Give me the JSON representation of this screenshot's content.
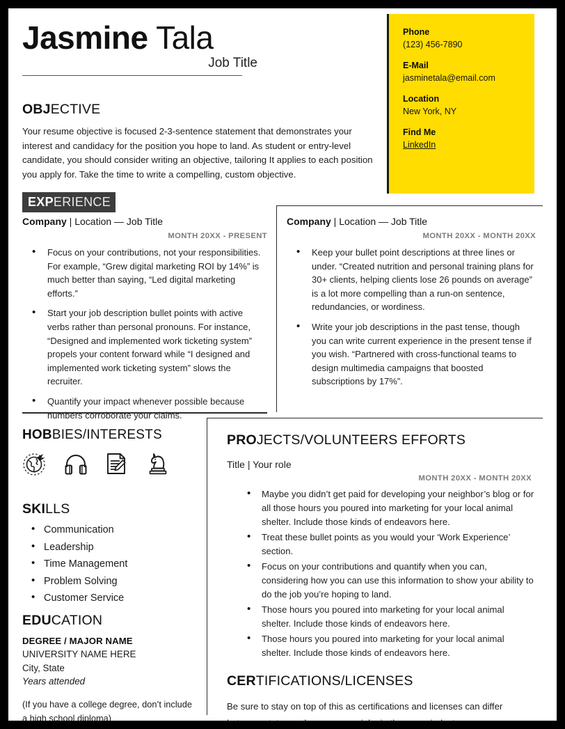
{
  "header": {
    "first_name": "Jasmine",
    "last_name": " Tala",
    "job_title": "Job Title"
  },
  "contact": {
    "phone_label": "Phone",
    "phone_value": "(123) 456-7890",
    "email_label": "E-Mail",
    "email_value": "jasminetala@email.com",
    "location_label": "Location",
    "location_value": "New York, NY",
    "findme_label": "Find Me",
    "findme_value": "LinkedIn",
    "panel_color": "#FFDD00"
  },
  "objective": {
    "title_bold": "OBJ",
    "title_light": "ECTIVE",
    "body": "Your resume objective is focused 2-3-sentence statement that demonstrates your interest and candidacy for the position you hope to land. As student or entry-level candidate, you should consider writing an objective, tailoring It applies to each position you apply for. Take the time to write a compelling, custom objective."
  },
  "experience": {
    "badge_bold": "EXP",
    "badge_light": "ERIENCE",
    "badge_color": "#3d3d3d",
    "jobs": [
      {
        "company": "Company",
        "separator": " | ",
        "meta": "Location — Job Title",
        "date": "MONTH 20XX - PRESENT",
        "bullets": [
          "Focus on your contributions, not your responsibilities. For example, “Grew digital marketing ROI by 14%” is much better than saying, “Led digital marketing efforts.”",
          "Start your job description bullet points with active verbs rather than personal pronouns. For instance, “Designed and implemented work ticketing system” propels your content forward while “I designed  and implemented work ticketing system” slows the recruiter.",
          "Quantify your impact whenever possible because numbers corroborate your claims."
        ]
      },
      {
        "company": "Company",
        "separator": " | ",
        "meta": "Location — Job Title",
        "date": "MONTH 20XX - MONTH 20XX",
        "bullets": [
          "Keep your bullet point descriptions at three lines or under. “Created nutrition and personal training plans for 30+ clients, helping clients lose 26 pounds on average” is a lot more compelling than a run-on sentence, redundancies, or wordiness.",
          "Write your job descriptions in the past tense, though you can write current experience in the present tense if you wish. “Partnered with cross-functional teams to design multimedia campaigns that  boosted subscriptions by 17%”."
        ]
      }
    ]
  },
  "hobbies": {
    "title_bold": "HOB",
    "title_light": "BIES/INTERESTS",
    "icons": [
      "travel-globe-icon",
      "headphones-icon",
      "writing-document-icon",
      "chess-knight-icon"
    ]
  },
  "skills": {
    "title_bold": "SKI",
    "title_light": "LLS",
    "items": [
      "Communication",
      "Leadership",
      "Time Management",
      "Problem Solving",
      "Customer Service"
    ]
  },
  "education": {
    "title_bold": "EDU",
    "title_light": "CATION",
    "degree": "DEGREE / MAJOR NAME",
    "university": "UNIVERSITY NAME HERE",
    "city_state": "City, State",
    "years": "Years attended",
    "note": "(If you have a college degree, don’t include a high school diploma)"
  },
  "projects": {
    "title_bold": "PRO",
    "title_light": "JECTS/VOLUNTEERS EFFORTS",
    "subtitle": "Title | Your role",
    "date": "MONTH 20XX - MONTH 20XX",
    "bullets": [
      "Maybe you didn’t get paid for developing your neighbor’s blog or for all those hours you poured into marketing for your local animal shelter. Include those kinds of endeavors here.",
      "Treat these bullet points as you would your ‘Work Experience’ section.",
      "Focus on your contributions and quantify when you can, considering how you can use this information to show your ability to do the job you’re hoping to land.",
      "Those hours you poured into marketing for your local animal shelter. Include those kinds of endeavors here.",
      "Those hours you poured into marketing for your local animal shelter. Include those kinds of endeavors here."
    ]
  },
  "certifications": {
    "title_bold": "CER",
    "title_light": "TIFICATIONS/LICENSES",
    "body": "Be sure to stay on top of this as certifications and licenses can differ between states and even across jobs in the same industry"
  }
}
